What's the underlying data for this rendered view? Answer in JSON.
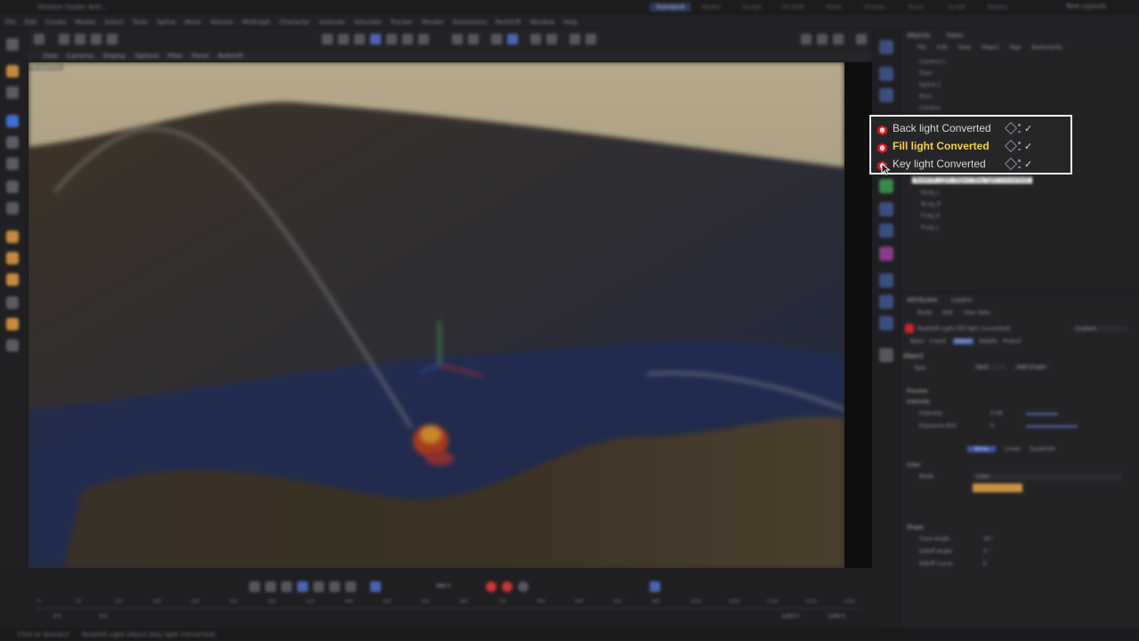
{
  "window": {
    "title": "Oktobre (Spider Bot)..."
  },
  "layout_tabs": [
    "Standard",
    "Model",
    "Sculpt",
    "UV Edit",
    "Paint",
    "Groom",
    "Track",
    "Script",
    "Nodes"
  ],
  "new_layouts_label": "New Layouts",
  "menubar": [
    "File",
    "Edit",
    "Create",
    "Modes",
    "Select",
    "Tools",
    "Spline",
    "Mesh",
    "Volume",
    "MoGraph",
    "Character",
    "Animate",
    "Simulate",
    "Tracker",
    "Render",
    "Extensions",
    "Redshift",
    "Window",
    "Help"
  ],
  "viewport": {
    "menu": [
      "View",
      "Cameras",
      "Display",
      "Options",
      "Filter",
      "Panel",
      "Redshift"
    ],
    "label": "Perspective"
  },
  "objects_panel": {
    "tabs": [
      "Objects",
      "Takes"
    ],
    "menu": [
      "File",
      "Edit",
      "View",
      "Object",
      "Tags",
      "Bookmarks"
    ],
    "rows_top": [
      "Camera.1",
      "Floor",
      "Spline.1",
      "Rock",
      "Camera"
    ],
    "rows_bottom": [
      "BLeg_L",
      "BLeg_R",
      "FLeg_R",
      "FLeg_L"
    ],
    "tooltip": "Redshift Light Object [Key light Converted]"
  },
  "highlight_rows": [
    {
      "label": "Back light Converted",
      "selected": false
    },
    {
      "label": "Fill light Converted",
      "selected": true
    },
    {
      "label": "Key light Converted",
      "selected": false
    }
  ],
  "attributes": {
    "tabs": [
      "Attributes",
      "Layers"
    ],
    "menu": [
      "Mode",
      "Edit",
      "User Data"
    ],
    "object_title": "Redshift Light [Fill light Converted]",
    "preset": "Custom",
    "subtabs": [
      "Basic",
      "Coord.",
      "Object",
      "Details",
      "Project"
    ],
    "section": "Object",
    "fields": [
      {
        "label": "Type",
        "value": "Spot"
      },
      {
        "label": "Intensity",
        "value": "0.08"
      },
      {
        "label": "Exposure (EV)",
        "value": "0"
      },
      {
        "label": "Mode",
        "value": "Color"
      },
      {
        "label": "Cone Angle",
        "value": "30 °"
      },
      {
        "label": "Falloff Angle",
        "value": "5 °"
      },
      {
        "label": "Falloff Curve",
        "value": "0"
      }
    ],
    "groups": [
      "Preview",
      "Intensity",
      "Color",
      "Shape"
    ],
    "add_graph": "Add Graph",
    "decay_options": [
      "None",
      "Linear",
      "Quadratic"
    ]
  },
  "timeline": {
    "frame_current": "960 F",
    "start": "0 F",
    "start2": "0 F",
    "end": "1260 F",
    "end2": "1260 F",
    "ticks": [
      "0",
      "60",
      "120",
      "180",
      "240",
      "300",
      "360",
      "420",
      "480",
      "540",
      "600",
      "660",
      "720",
      "780",
      "840",
      "900",
      "960",
      "1020",
      "1080",
      "1140",
      "1200",
      "1260"
    ]
  },
  "status": {
    "left": "Click to deselect",
    "message": "Redshift Light Object [Key light Converted]"
  },
  "colors": {
    "selected_text": "#f0d24a",
    "highlight_border": "#f2f2f2",
    "light_icon": "#d3222c",
    "accent_blue": "#4a63b5"
  }
}
